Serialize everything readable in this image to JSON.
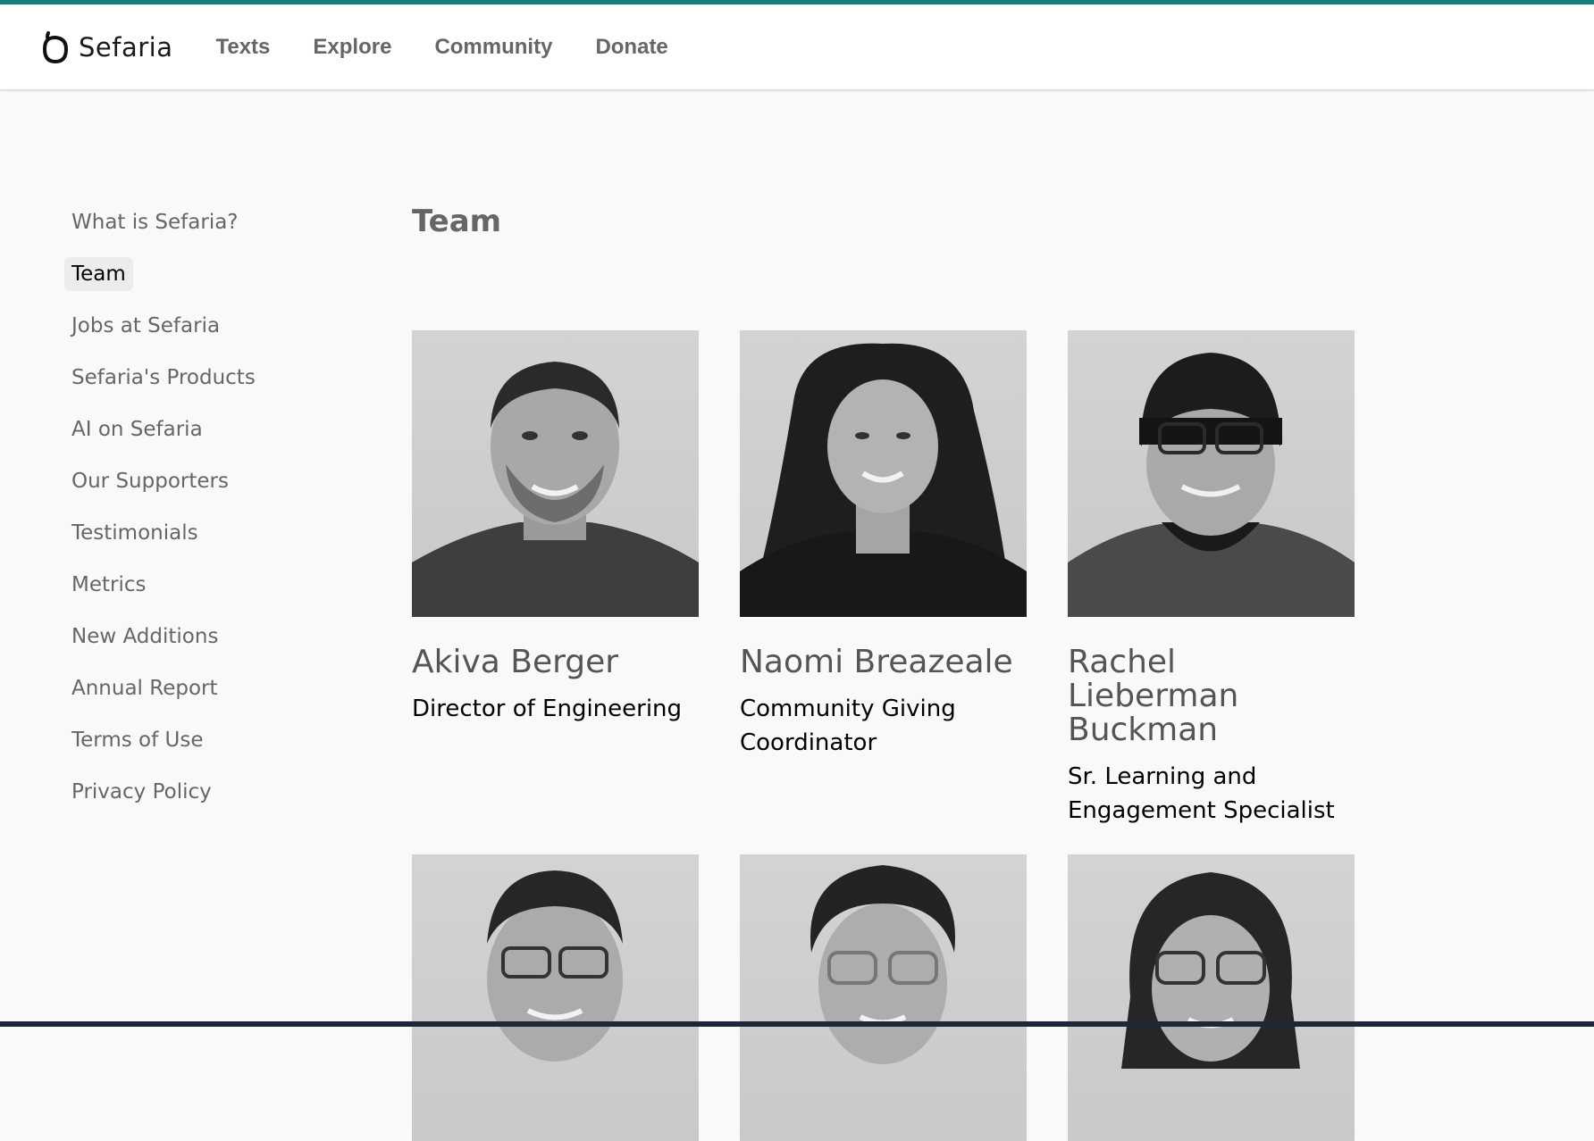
{
  "header": {
    "logo_text": "Sefaria",
    "nav": [
      "Texts",
      "Explore",
      "Community",
      "Donate"
    ]
  },
  "sidebar": {
    "items": [
      {
        "label": "What is Sefaria?",
        "active": false
      },
      {
        "label": "Team",
        "active": true
      },
      {
        "label": "Jobs at Sefaria",
        "active": false
      },
      {
        "label": "Sefaria's Products",
        "active": false
      },
      {
        "label": "AI on Sefaria",
        "active": false
      },
      {
        "label": "Our Supporters",
        "active": false
      },
      {
        "label": "Testimonials",
        "active": false
      },
      {
        "label": "Metrics",
        "active": false
      },
      {
        "label": "New Additions",
        "active": false
      },
      {
        "label": "Annual Report",
        "active": false
      },
      {
        "label": "Terms of Use",
        "active": false
      },
      {
        "label": "Privacy Policy",
        "active": false
      }
    ]
  },
  "main": {
    "title": "Team",
    "team": [
      {
        "name": "Akiva Berger",
        "role": "Director of Engineering"
      },
      {
        "name": "Naomi Breazeale",
        "role": "Community Giving Coordinator"
      },
      {
        "name": "Rachel Lieberman Buckman",
        "role": "Sr. Learning and Engagement Specialist"
      },
      {
        "name": "",
        "role": ""
      },
      {
        "name": "",
        "role": ""
      },
      {
        "name": "",
        "role": ""
      }
    ]
  },
  "colors": {
    "accent_line": "#17807c",
    "footer": "#1c2838",
    "nav_text": "#666666"
  }
}
